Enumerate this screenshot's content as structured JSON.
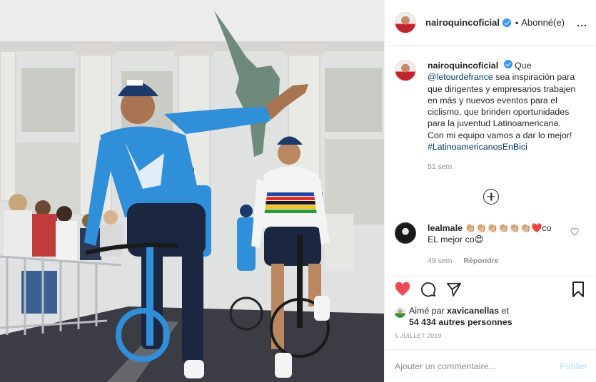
{
  "post": {
    "author": "nairoquincoficial",
    "verified": true,
    "follow_status": "Abonné(e)",
    "separator": "•",
    "more_label": "...",
    "photo_alt": "Cyclists in Movistar jerseys riding past crowd"
  },
  "caption": {
    "username": "nairoquincoficial",
    "text_before": "Que",
    "mention": "@letourdefrance",
    "text_after": "sea inspiración para que dirigentes y empresarios trabajen en más y nuevos eventos para el ciclismo, que brinden oportunidades para la juventud Latinoamericana. Con mi equipo vamos a dar lo mejor!",
    "hashtag": "#LatinoamericanosEnBici",
    "time": "51 sem"
  },
  "comment": {
    "username": "lealmale",
    "text_part1": "👏🏼👏🏼👏🏼👏🏼👏🏼👏🏼❤️co",
    "text_part2": "EL mejor co😍",
    "time": "49 sem",
    "reply_label": "Répondre"
  },
  "likes": {
    "prefix": "Aimé par",
    "user": "xavicanellas",
    "suffix": "et",
    "count": "54 434 autres personnes"
  },
  "date": "5 JUILLET 2019",
  "add_comment": {
    "placeholder": "Ajouter un commentaire...",
    "publish_label": "Publier"
  },
  "colors": {
    "verified": "#3897f0",
    "link": "#00376b",
    "like_red": "#ed4956",
    "publish_disabled": "#b2dffc",
    "jersey_blue": "#2f8fd8"
  },
  "icons": {
    "like": "heart-icon",
    "comment": "comment-icon",
    "share": "share-icon",
    "save": "bookmark-icon",
    "load_more": "plus-circle-icon"
  }
}
